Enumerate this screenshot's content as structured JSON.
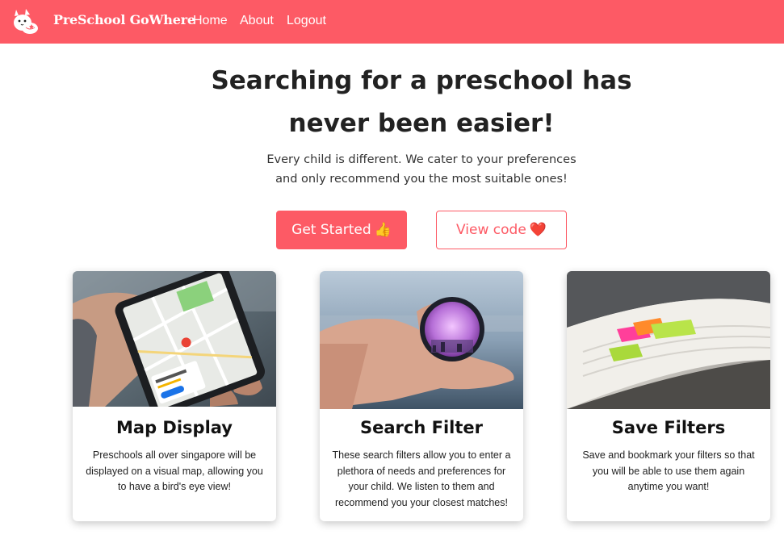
{
  "navbar": {
    "brand": "PreSchool GoWhere",
    "links": [
      "Home",
      "About",
      "Logout"
    ],
    "logo_icon": "cat-logo-icon",
    "background": "#fd5a65"
  },
  "hero": {
    "title_line1": "Searching for a preschool has",
    "title_line2": "never been easier!",
    "subtitle_line1": "Every child is different. We cater to your preferences",
    "subtitle_line2": "and only recommend you the most suitable ones!",
    "primary_button": "Get Started",
    "primary_emoji": "👍",
    "secondary_button": "View code",
    "secondary_emoji": "❤️"
  },
  "cards": [
    {
      "title": "Map Display",
      "text": "Preschools all over singapore will be displayed on a visual map, allowing you to have a bird's eye view!",
      "image": "phone-map-image"
    },
    {
      "title": "Search Filter",
      "text": "These search filters allow you to enter a plethora of needs and preferences for your child. We listen to them and recommend you your closest matches!",
      "image": "lens-in-hand-image"
    },
    {
      "title": "Save Filters",
      "text": "Save and bookmark your filters so that you will be able to use them again anytime you want!",
      "image": "sticky-bookmarks-image"
    }
  ],
  "colors": {
    "accent": "#fd5a65",
    "text": "#212529"
  }
}
